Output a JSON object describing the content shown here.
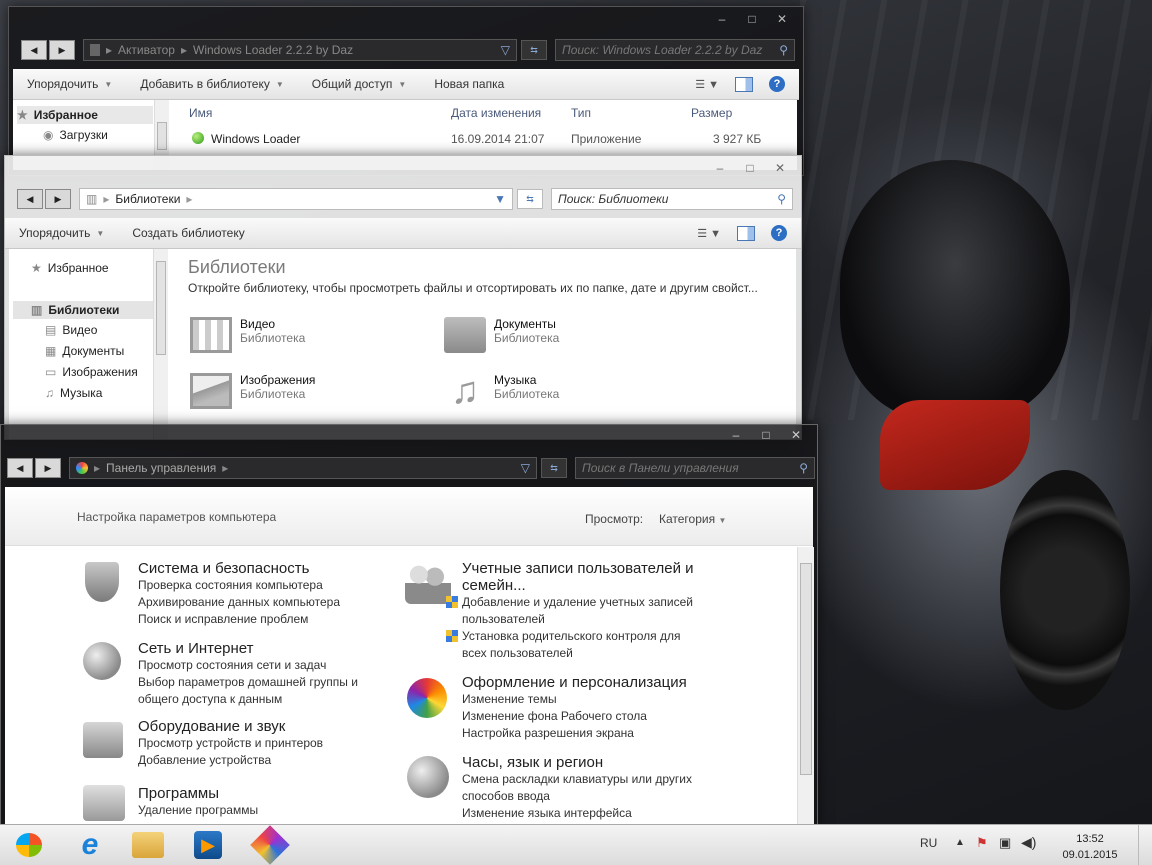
{
  "win1": {
    "address": [
      "Активатор",
      "Windows Loader 2.2.2 by Daz"
    ],
    "search_placeholder": "Поиск: Windows Loader 2.2.2 by Daz",
    "toolbar": [
      "Упорядочить",
      "Добавить в библиотеку",
      "Общий доступ",
      "Новая папка"
    ],
    "columns": [
      "Имя",
      "Дата изменения",
      "Тип",
      "Размер"
    ],
    "file": {
      "name": "Windows Loader",
      "date": "16.09.2014 21:07",
      "type": "Приложение",
      "size": "3 927 КБ"
    },
    "sidebar": {
      "favorites": "Избранное",
      "downloads": "Загрузки"
    }
  },
  "win2": {
    "address": "Библиотеки",
    "search_placeholder": "Поиск: Библиотеки",
    "toolbar": [
      "Упорядочить",
      "Создать библиотеку"
    ],
    "sidebar": {
      "favorites": "Избранное",
      "libraries": "Библиотеки",
      "items": [
        "Видео",
        "Документы",
        "Изображения",
        "Музыка"
      ]
    },
    "title": "Библиотеки",
    "subtitle": "Откройте библиотеку, чтобы просмотреть файлы и отсортировать их по папке, дате и другим свойст...",
    "libraries": [
      {
        "name": "Видео",
        "sub": "Библиотека",
        "icon": "video-icon"
      },
      {
        "name": "Документы",
        "sub": "Библиотека",
        "icon": "documents-icon"
      },
      {
        "name": "Изображения",
        "sub": "Библиотека",
        "icon": "pictures-icon"
      },
      {
        "name": "Музыка",
        "sub": "Библиотека",
        "icon": "music-icon"
      }
    ]
  },
  "win3": {
    "address": "Панель управления",
    "search_placeholder": "Поиск в Панели управления",
    "heading": "Настройка параметров компьютера",
    "view_label": "Просмотр:",
    "view_value": "Категория",
    "categories_left": [
      {
        "title": "Система и безопасность",
        "icon": "shield-icon",
        "links": [
          "Проверка состояния компьютера",
          "Архивирование данных компьютера",
          "Поиск и исправление проблем"
        ]
      },
      {
        "title": "Сеть и Интернет",
        "icon": "network-globe-icon",
        "links": [
          "Просмотр состояния сети и задач",
          "Выбор параметров домашней группы и",
          "общего доступа к данным"
        ]
      },
      {
        "title": "Оборудование и звук",
        "icon": "printer-icon",
        "links": [
          "Просмотр устройств и принтеров",
          "Добавление устройства"
        ]
      },
      {
        "title": "Программы",
        "icon": "programs-icon",
        "links": [
          "Удаление программы"
        ]
      }
    ],
    "categories_right": [
      {
        "title": "Учетные записи пользователей и",
        "title2": "семейн...",
        "icon": "users-icon",
        "links": [
          "Добавление и удаление учетных записей",
          "пользователей",
          "Установка родительского контроля для",
          "всех пользователей"
        ]
      },
      {
        "title": "Оформление и персонализация",
        "icon": "personalization-icon",
        "links": [
          "Изменение темы",
          "Изменение фона Рабочего стола",
          "Настройка разрешения экрана"
        ]
      },
      {
        "title": "Часы, язык и регион",
        "icon": "clock-globe-icon",
        "links": [
          "Смена раскладки клавиатуры или других",
          "способов ввода",
          "Изменение языка интерфейса"
        ]
      }
    ]
  },
  "taskbar": {
    "lang": "RU",
    "time": "13:52",
    "date": "09.01.2015",
    "apps": [
      "internet-explorer-icon",
      "explorer-icon",
      "media-player-icon",
      "winrar-icon"
    ]
  }
}
